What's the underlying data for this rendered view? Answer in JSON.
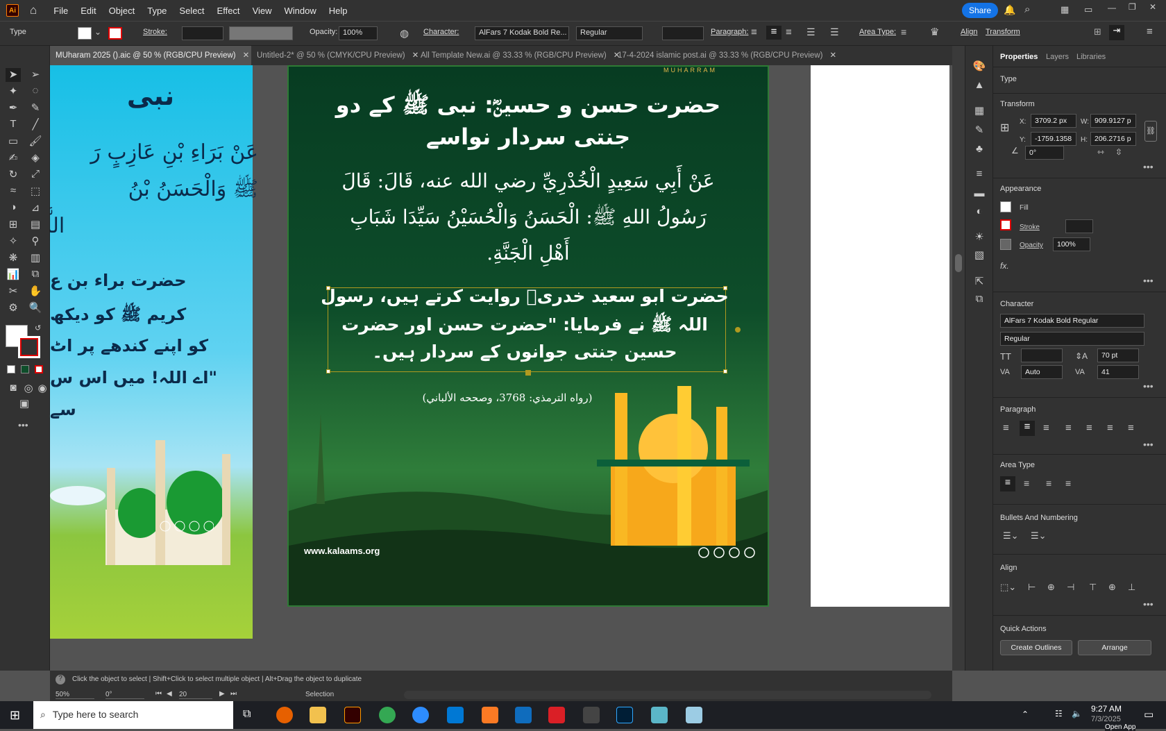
{
  "app": {
    "logo": "Ai",
    "share": "Share"
  },
  "menu": [
    "File",
    "Edit",
    "Object",
    "Type",
    "Select",
    "Effect",
    "View",
    "Window",
    "Help"
  ],
  "control": {
    "type_label": "Type",
    "stroke_label": "Stroke:",
    "opacity_label": "Opacity:",
    "opacity_value": "100%",
    "character_label": "Character:",
    "font_name": "AlFars 7 Kodak Bold Re...",
    "font_style": "Regular",
    "paragraph_label": "Paragraph:",
    "area_type_label": "Area Type:",
    "align_label": "Align",
    "transform_label": "Transform"
  },
  "tabs": [
    {
      "label": "MUharam 2025 ().aic @ 50 % (RGB/CPU Preview)"
    },
    {
      "label": "Untitled-2* @ 50 % (CMYK/CPU Preview)"
    },
    {
      "label": "All Template New.ai @ 33.33 % (RGB/CPU Preview)"
    },
    {
      "label": "17-4-2024 islamic post.ai @ 33.33 % (RGB/CPU Preview)"
    }
  ],
  "artboard_left": {
    "title": "نبی",
    "arabic_1": "عَنْ بَرَاءِ بْنِ عَازِبٍ رَ",
    "arabic_2": "ﷺ وَالْحَسَنُ بْنُ",
    "arabic_3": "اللَّهُمَّ",
    "urdu_1": "حضرت براء بن ع",
    "urdu_2": "کریم ﷺ کو دیکھ",
    "urdu_3": "کو اپنے کندھے پر اٹ",
    "urdu_4": "\"اے اللہ! میں اس س",
    "urdu_5": "سے"
  },
  "artboard_main": {
    "top_label": "MUHARRAM",
    "title_line1": "حضرت حسن و حسینؓ: نبی ﷺ کے دو",
    "title_line2": "جنتی سردار نواسے",
    "hadith_line1": "عَنْ أَبِي سَعِيدٍ الْخُدْرِيِّ رضي الله عنه، قَالَ: قَالَ",
    "hadith_line2": "رَسُولُ اللهِ ﷺ: الْحَسَنُ وَالْحُسَيْنُ سَيِّدَا شَبَابِ",
    "hadith_line3": "أَهْلِ الْجَنَّةِ.",
    "urdu_line1": "حضرت ابو سعید خدریؓ روایت کرتے ہیں، رسول",
    "urdu_line2": "اللہ ﷺ نے فرمایا: \"حضرت حسن اور حضرت",
    "urdu_line3": "حسین جنتی جوانوں کے سردار ہیں۔",
    "reference": "(رواه الترمذي: 3768، وصححه الألباني)",
    "website": "www.kalaams.org"
  },
  "panel": {
    "tabs": [
      "Properties",
      "Layers",
      "Libraries"
    ],
    "section_type": "Type",
    "transform": {
      "title": "Transform",
      "x_label": "X:",
      "x": "3709.2 px",
      "y_label": "Y:",
      "y": "-1759.1358",
      "w_label": "W:",
      "w": "909.9127 p",
      "h_label": "H:",
      "h": "206.2716 p",
      "angle": "0°"
    },
    "appearance": {
      "title": "Appearance",
      "fill": "Fill",
      "stroke": "Stroke",
      "opacity": "Opacity",
      "opacity_value": "100%",
      "fx": "fx."
    },
    "character": {
      "title": "Character",
      "font": "AlFars 7 Kodak Bold Regular",
      "style": "Regular",
      "leading": "70 pt",
      "kerning": "Auto",
      "tracking": "41"
    },
    "paragraph_title": "Paragraph",
    "area_type_title": "Area Type",
    "bullets_title": "Bullets And Numbering",
    "align_title": "Align",
    "quick_actions": {
      "title": "Quick Actions",
      "create_outlines": "Create Outlines",
      "arrange": "Arrange"
    }
  },
  "status": {
    "hint": "Click the object to select  |  Shift+Click to select multiple object  |  Alt+Drag the object to duplicate",
    "zoom": "50%",
    "rotation": "0°",
    "artboard": "20",
    "tool": "Selection"
  },
  "taskbar": {
    "search": "Type here to search",
    "time": "9:27 AM",
    "date": "7/3/2025",
    "open_app": "Open App"
  },
  "colors": {
    "accent": "#1473e6",
    "ai_orange": "#ff9a00"
  }
}
